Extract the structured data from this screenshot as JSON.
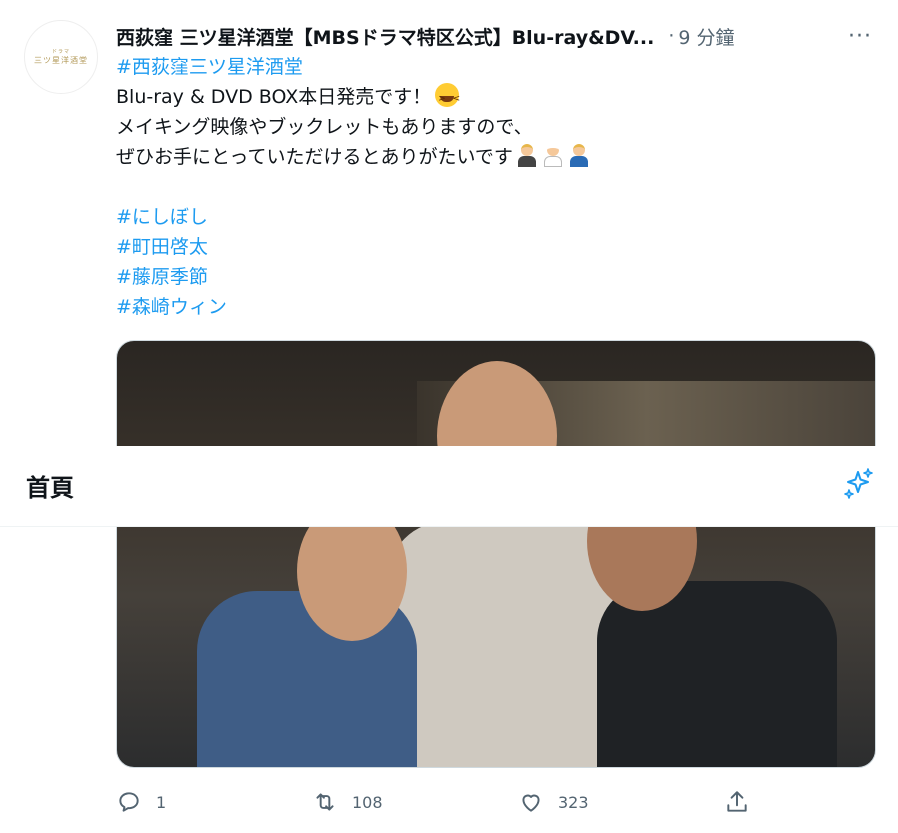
{
  "tweet": {
    "author_name": "西荻窪 三ツ星洋酒堂【MBSドラマ特区公式】Blu-ray&DV...",
    "separator": "·",
    "time": "9 分鐘",
    "more": "···",
    "avatar_logo_top": "ドラマ",
    "avatar_logo_main": "三ツ星洋酒堂",
    "lines": {
      "hashtag_title": "#西荻窪三ツ星洋酒堂",
      "line1": "Blu-ray & DVD BOX本日発売です！",
      "line2": "メイキング映像やブックレットもありますので、",
      "line3": "ぜひお手にとっていただけるとありがたいです"
    },
    "hashtags": [
      "#にしぼし",
      "#町田啓太",
      "#藤原季節",
      "#森崎ウィン"
    ],
    "emoji_icons": [
      "grinning-squinting-face",
      "man-in-tuxedo",
      "cook",
      "office-worker"
    ],
    "stats": {
      "reply": "1",
      "retweet": "108",
      "like": "323"
    }
  },
  "overlay": {
    "title": "首頁",
    "icon": "sparkle-icon"
  },
  "colors": {
    "link": "#1d9bf0",
    "muted": "#536471",
    "text": "#0f1419"
  }
}
